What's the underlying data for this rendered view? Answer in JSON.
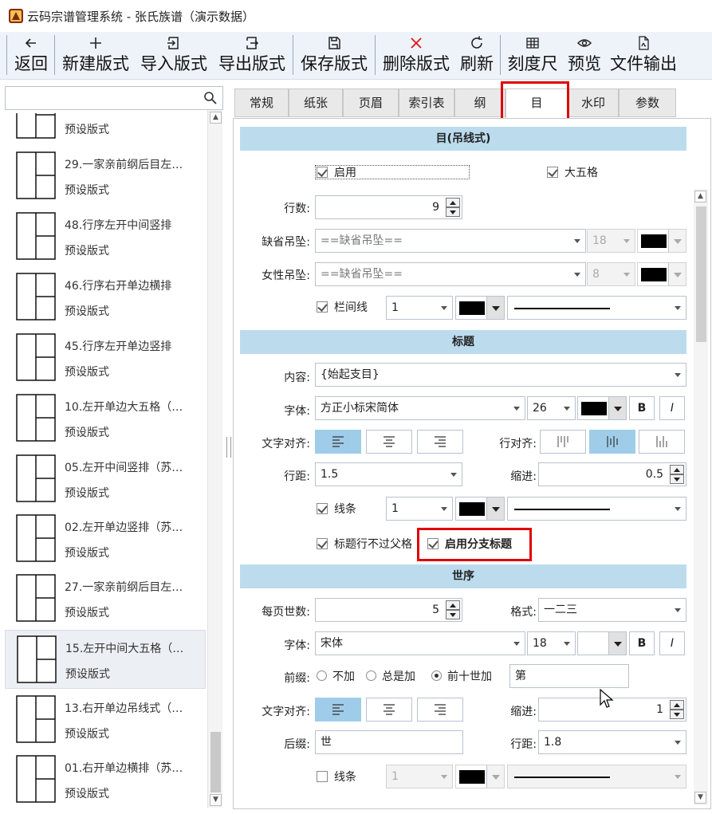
{
  "window": {
    "title": "云码宗谱管理系统 - 张氏族谱（演示数据）"
  },
  "toolbar": {
    "back": "返回",
    "new": "新建版式",
    "import": "导入版式",
    "export": "导出版式",
    "save": "保存版式",
    "delete": "删除版式",
    "refresh": "刷新",
    "ruler": "刻度尺",
    "preview": "预览",
    "output": "文件输出"
  },
  "sidebar": {
    "search_value": "",
    "items": [
      {
        "name": "",
        "sub": "预设版式"
      },
      {
        "name": "29.一家亲前纲后目左…",
        "sub": "预设版式"
      },
      {
        "name": "48.行序左开中间竖排",
        "sub": "预设版式"
      },
      {
        "name": "46.行序右开单边横排",
        "sub": "预设版式"
      },
      {
        "name": "45.行序左开单边竖排",
        "sub": "预设版式"
      },
      {
        "name": "10.左开单边大五格（…",
        "sub": "预设版式"
      },
      {
        "name": "05.左开中间竖排（苏…",
        "sub": "预设版式"
      },
      {
        "name": "02.左开单边竖排（苏…",
        "sub": "预设版式"
      },
      {
        "name": "27.一家亲前纲后目左…",
        "sub": "预设版式"
      },
      {
        "name": "15.左开中间大五格（…",
        "sub": "预设版式"
      },
      {
        "name": "13.右开单边吊线式（…",
        "sub": "预设版式"
      },
      {
        "name": "01.右开单边横排（苏…",
        "sub": "预设版式"
      }
    ]
  },
  "tabs": [
    "常规",
    "纸张",
    "页眉",
    "索引表",
    "纲",
    "目",
    "水印",
    "参数"
  ],
  "sec1": {
    "header": "目(吊线式)",
    "enable": "启用",
    "big_five": "大五格",
    "rows_label": "行数:",
    "rows_value": "9",
    "default_label": "缺省吊坠:",
    "default_value": "==缺省吊坠==",
    "default_size": "18",
    "female_label": "女性吊坠:",
    "female_value": "==缺省吊坠==",
    "female_size": "8",
    "colline_label": "栏间线",
    "colline_width": "1"
  },
  "sec2": {
    "header": "标题",
    "content_label": "内容:",
    "content_value": "{始起支目}",
    "font_label": "字体:",
    "font_value": "方正小标宋简体",
    "font_size": "26",
    "bold": "B",
    "italic": "I",
    "align_label": "文字对齐:",
    "row_align_label": "行对齐:",
    "spacing_label": "行距:",
    "spacing_value": "1.5",
    "indent_label": "缩进:",
    "indent_value": "0.5",
    "line_label": "线条",
    "line_width": "1",
    "no_cross": "标题行不过父格",
    "branch_title": "启用分支标题"
  },
  "sec3": {
    "header": "世序",
    "per_page_label": "每页世数:",
    "per_page_value": "5",
    "format_label": "格式:",
    "format_value": "一二三",
    "font_label": "字体:",
    "font_value": "宋体",
    "font_size": "18",
    "bold": "B",
    "italic": "I",
    "prefix_label": "前缀:",
    "prefix_opt1": "不加",
    "prefix_opt2": "总是加",
    "prefix_opt3": "前十世加",
    "prefix_value": "第",
    "align_label": "文字对齐:",
    "indent_label": "缩进:",
    "indent_value": "1",
    "suffix_label": "后缀:",
    "suffix_value": "世",
    "spacing_label": "行距:",
    "spacing_value": "1.8",
    "line_label": "线条",
    "line_width": "1"
  }
}
